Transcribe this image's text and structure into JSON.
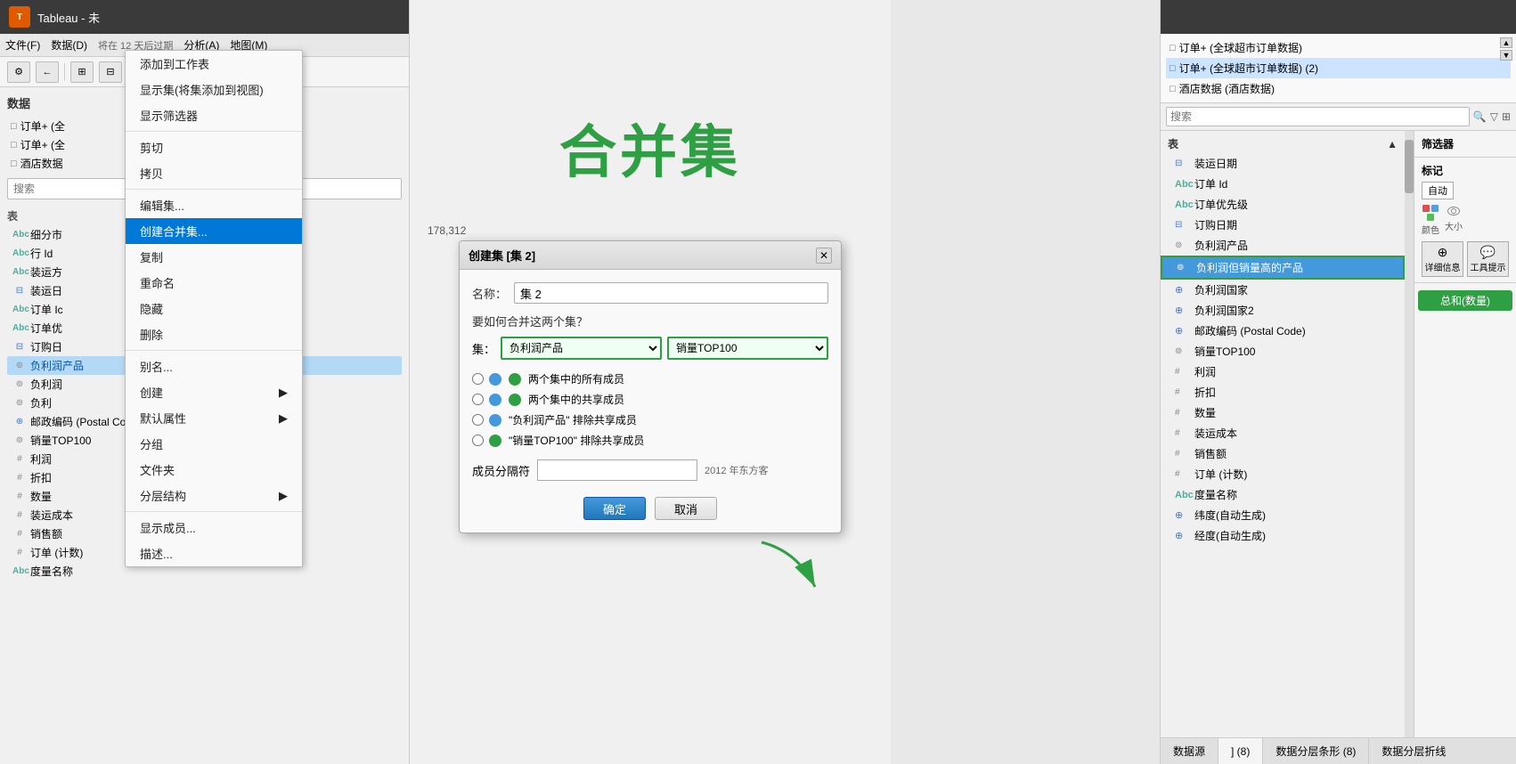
{
  "app": {
    "title": "Tableau - 未",
    "icon_label": "T"
  },
  "menu": {
    "items": [
      "文件(F)",
      "数据(D)",
      "分析(A)",
      "地图(M)"
    ]
  },
  "left_sidebar": {
    "section_label": "数据",
    "search_placeholder": "搜索",
    "data_sources": [
      {
        "label": "订单+ (全",
        "icon": "□"
      },
      {
        "label": "订单+ (全",
        "icon": "□"
      },
      {
        "label": "酒店数据",
        "icon": "□"
      }
    ],
    "table_section": "表",
    "fields": [
      {
        "label": "细分市",
        "type": "abc"
      },
      {
        "label": "行 Id",
        "type": "abc"
      },
      {
        "label": "装运方",
        "type": "abc"
      },
      {
        "label": "装运日",
        "type": "calendar"
      },
      {
        "label": "订单 Ic",
        "type": "abc"
      },
      {
        "label": "订单优",
        "type": "abc"
      },
      {
        "label": "订购日",
        "type": "calendar"
      },
      {
        "label": "负利润产品",
        "type": "circle",
        "highlighted": true
      },
      {
        "label": "负利润",
        "type": "circle"
      },
      {
        "label": "负利",
        "type": "circle"
      },
      {
        "label": "邮政编码 (Postal Code)",
        "type": "globe"
      },
      {
        "label": "销量TOP100",
        "type": "circle"
      },
      {
        "label": "利润",
        "type": "hash"
      },
      {
        "label": "折扣",
        "type": "hash"
      },
      {
        "label": "数量",
        "type": "hash"
      },
      {
        "label": "装运成本",
        "type": "hash"
      },
      {
        "label": "销售额",
        "type": "hash"
      },
      {
        "label": "订单 (计数)",
        "type": "hash"
      },
      {
        "label": "度量名称",
        "type": "abc"
      }
    ]
  },
  "context_menu": {
    "items": [
      {
        "label": "添加到工作表",
        "id": "add-to-worksheet"
      },
      {
        "label": "显示集(将集添加到视图)",
        "id": "show-set"
      },
      {
        "label": "显示筛选器",
        "id": "show-filter"
      },
      {
        "label": "剪切",
        "id": "cut"
      },
      {
        "label": "拷贝",
        "id": "copy"
      },
      {
        "label": "编辑集...",
        "id": "edit-set"
      },
      {
        "label": "创建合并集...",
        "id": "create-combined-set",
        "highlighted": true
      },
      {
        "label": "复制",
        "id": "duplicate"
      },
      {
        "label": "重命名",
        "id": "rename"
      },
      {
        "label": "隐藏",
        "id": "hide"
      },
      {
        "label": "删除",
        "id": "delete"
      },
      {
        "label": "别名...",
        "id": "alias"
      },
      {
        "label": "创建",
        "id": "create",
        "has_sub": true
      },
      {
        "label": "默认属性",
        "id": "default-props",
        "has_sub": true
      },
      {
        "label": "分组",
        "id": "group"
      },
      {
        "label": "文件夹",
        "id": "folder"
      },
      {
        "label": "分层结构",
        "id": "hierarchy",
        "has_sub": true
      },
      {
        "label": "显示成员...",
        "id": "show-members"
      },
      {
        "label": "描述...",
        "id": "describe"
      }
    ]
  },
  "center": {
    "title": "合并集",
    "dialog": {
      "title": "创建集 [集 2]",
      "close_btn": "✕",
      "name_label": "名称：",
      "name_value": "集 2",
      "question_label": "要如何合并这两个集？",
      "set_label": "集：",
      "set1_value": "负利润产品",
      "set2_value": "销量TOP100",
      "radio_options": [
        {
          "label": "两个集中的所有成员",
          "id": "all-members"
        },
        {
          "label": "两个集中的共享成员",
          "id": "shared-members"
        },
        {
          "label": "\"负利润产品\" 排除共享成员",
          "id": "exclude-set1"
        },
        {
          "label": "\"销量TOP100\" 排除共享成员",
          "id": "exclude-set2"
        }
      ],
      "member_separator_label": "成员分隔符",
      "member_separator_note": "2012 年东方客",
      "ok_btn": "确定",
      "cancel_btn": "取消",
      "hint_value": "178,312"
    }
  },
  "right_panel": {
    "data_sources": [
      {
        "label": "订单+ (全球超市订单数据)",
        "icon": "□"
      },
      {
        "label": "订单+ (全球超市订单数据) (2)",
        "icon": "□",
        "selected": true
      },
      {
        "label": "酒店数据 (酒店数据)",
        "icon": "□"
      }
    ],
    "search_placeholder": "搜索",
    "table_section": "表",
    "fields_top": [
      {
        "label": "装运日期",
        "type": "calendar"
      },
      {
        "label": "订单 Id",
        "type": "abc"
      },
      {
        "label": "订单优先级",
        "type": "abc"
      },
      {
        "label": "订购日期",
        "type": "calendar"
      },
      {
        "label": "负利润产品",
        "type": "circle"
      },
      {
        "label": "负利润但销量高的产品",
        "type": "circle",
        "highlighted": true
      },
      {
        "label": "负利润国家",
        "type": "globe"
      },
      {
        "label": "负利润国家2",
        "type": "globe"
      },
      {
        "label": "邮政编码 (Postal Code)",
        "type": "globe"
      },
      {
        "label": "销量TOP100",
        "type": "circle"
      },
      {
        "label": "利润",
        "type": "hash"
      },
      {
        "label": "折扣",
        "type": "hash"
      },
      {
        "label": "数量",
        "type": "hash"
      },
      {
        "label": "装运成本",
        "type": "hash"
      },
      {
        "label": "销售额",
        "type": "hash"
      },
      {
        "label": "订单 (计数)",
        "type": "hash"
      },
      {
        "label": "度量名称",
        "type": "abc"
      },
      {
        "label": "纬度(自动生成)",
        "type": "globe"
      },
      {
        "label": "经度(自动生成)",
        "type": "globe"
      }
    ],
    "bottom_tabs": [
      "数据源",
      "] (8)",
      "数据分层条形 (8)",
      "数据分层折线"
    ],
    "filters_title": "筛选器",
    "marks_title": "标记",
    "auto_label": "自动",
    "marks_icons": [
      "颜色",
      "大小",
      "详细信息",
      "工具提示"
    ],
    "total_label": "总和(数量)"
  }
}
